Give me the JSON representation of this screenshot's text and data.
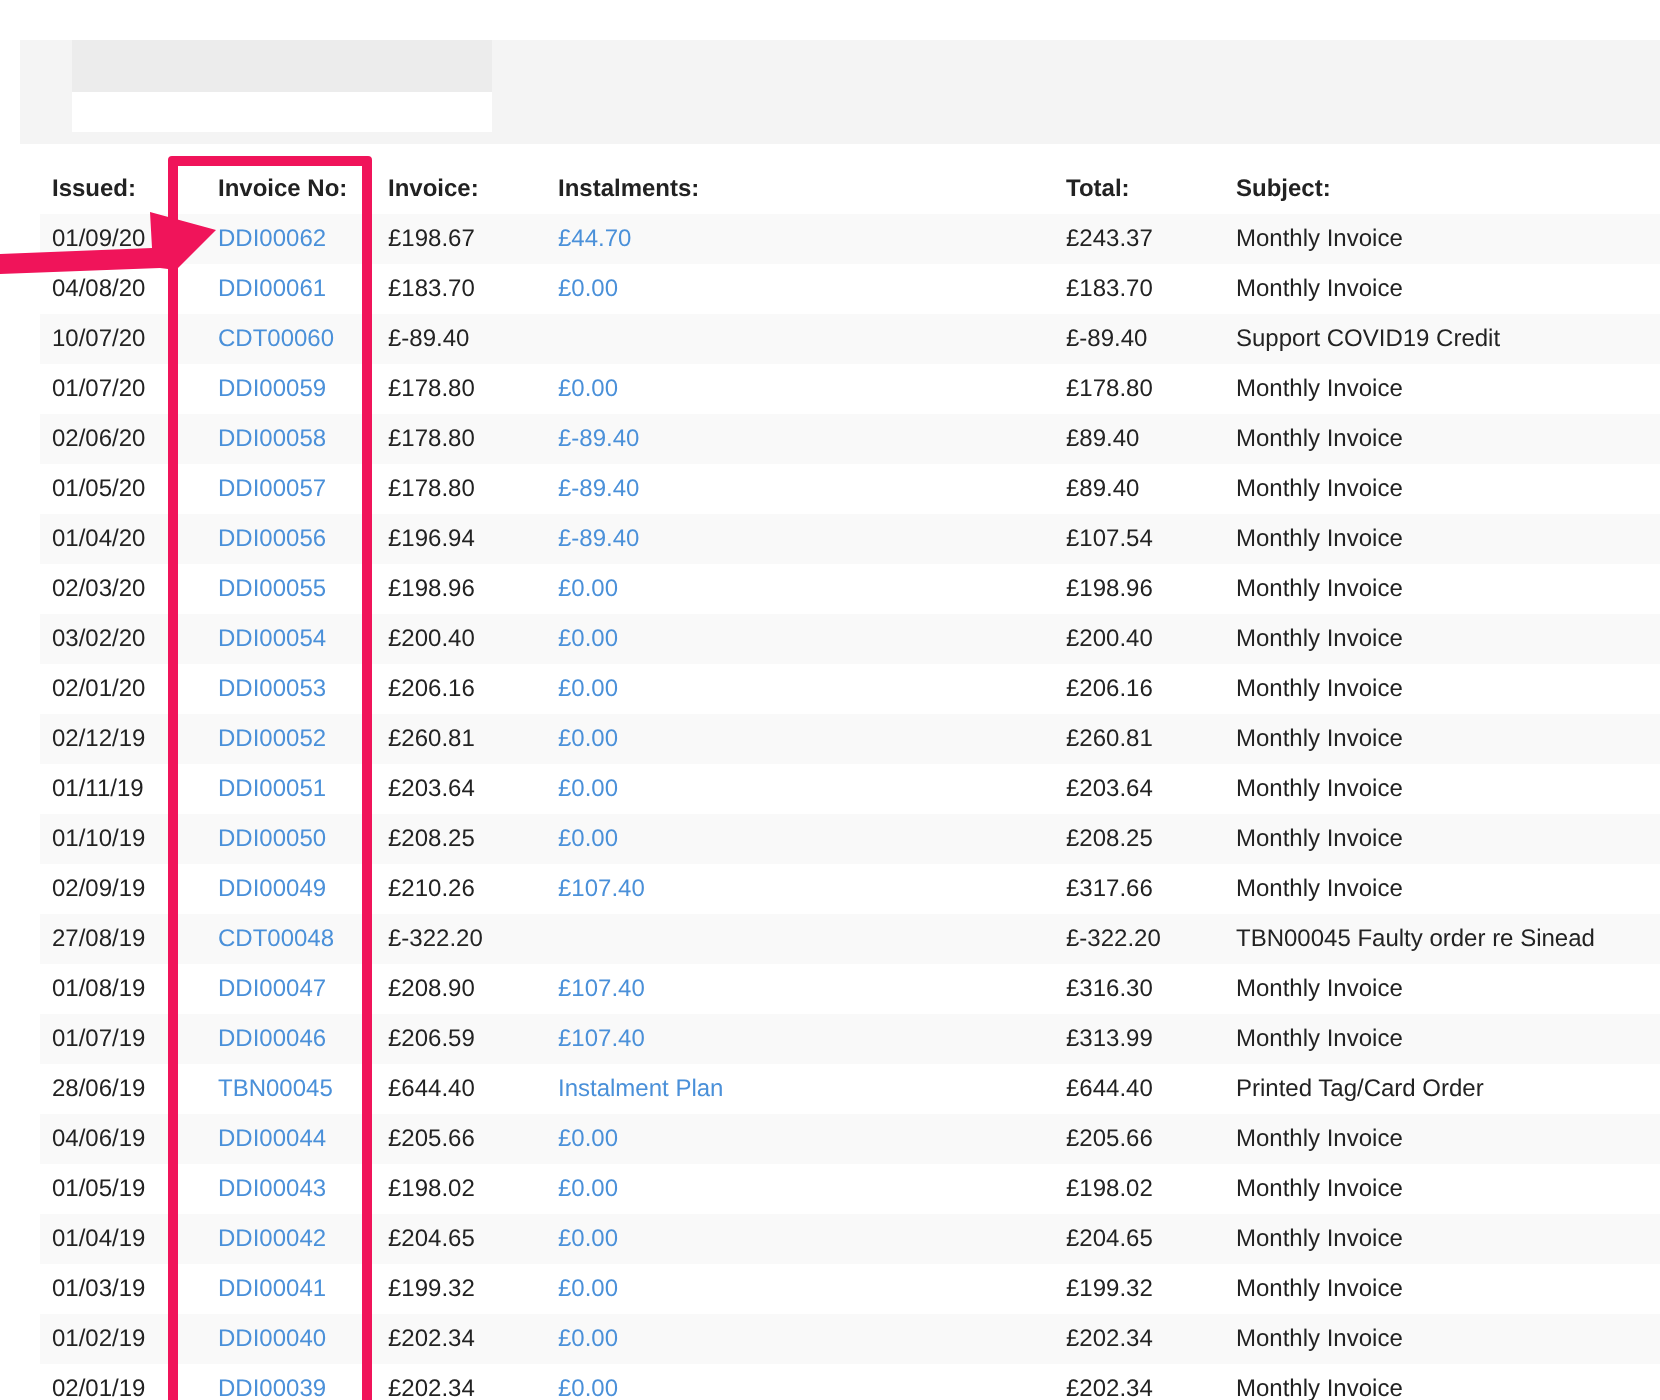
{
  "table": {
    "columns": [
      "Issued:",
      "Invoice No:",
      "Invoice:",
      "Instalments:",
      "Total:",
      "Subject:"
    ],
    "rows": [
      {
        "issued": "01/09/20",
        "invoice_no": "DDI00062",
        "invoice": "£198.67",
        "instalments": "£44.70",
        "total": "£243.37",
        "subject": "Monthly Invoice"
      },
      {
        "issued": "04/08/20",
        "invoice_no": "DDI00061",
        "invoice": "£183.70",
        "instalments": "£0.00",
        "total": "£183.70",
        "subject": "Monthly Invoice"
      },
      {
        "issued": "10/07/20",
        "invoice_no": "CDT00060",
        "invoice": "£-89.40",
        "total": "£-89.40",
        "subject": "Support COVID19 Credit"
      },
      {
        "issued": "01/07/20",
        "invoice_no": "DDI00059",
        "invoice": "£178.80",
        "instalments": "£0.00",
        "total": "£178.80",
        "subject": "Monthly Invoice"
      },
      {
        "issued": "02/06/20",
        "invoice_no": "DDI00058",
        "invoice": "£178.80",
        "instalments": "£-89.40",
        "total": "£89.40",
        "subject": "Monthly Invoice"
      },
      {
        "issued": "01/05/20",
        "invoice_no": "DDI00057",
        "invoice": "£178.80",
        "instalments": "£-89.40",
        "total": "£89.40",
        "subject": "Monthly Invoice"
      },
      {
        "issued": "01/04/20",
        "invoice_no": "DDI00056",
        "invoice": "£196.94",
        "instalments": "£-89.40",
        "total": "£107.54",
        "subject": "Monthly Invoice"
      },
      {
        "issued": "02/03/20",
        "invoice_no": "DDI00055",
        "invoice": "£198.96",
        "instalments": "£0.00",
        "total": "£198.96",
        "subject": "Monthly Invoice"
      },
      {
        "issued": "03/02/20",
        "invoice_no": "DDI00054",
        "invoice": "£200.40",
        "instalments": "£0.00",
        "total": "£200.40",
        "subject": "Monthly Invoice"
      },
      {
        "issued": "02/01/20",
        "invoice_no": "DDI00053",
        "invoice": "£206.16",
        "instalments": "£0.00",
        "total": "£206.16",
        "subject": "Monthly Invoice"
      },
      {
        "issued": "02/12/19",
        "invoice_no": "DDI00052",
        "invoice": "£260.81",
        "instalments": "£0.00",
        "total": "£260.81",
        "subject": "Monthly Invoice"
      },
      {
        "issued": "01/11/19",
        "invoice_no": "DDI00051",
        "invoice": "£203.64",
        "instalments": "£0.00",
        "total": "£203.64",
        "subject": "Monthly Invoice"
      },
      {
        "issued": "01/10/19",
        "invoice_no": "DDI00050",
        "invoice": "£208.25",
        "instalments": "£0.00",
        "total": "£208.25",
        "subject": "Monthly Invoice"
      },
      {
        "issued": "02/09/19",
        "invoice_no": "DDI00049",
        "invoice": "£210.26",
        "instalments": "£107.40",
        "total": "£317.66",
        "subject": "Monthly Invoice"
      },
      {
        "issued": "27/08/19",
        "invoice_no": "CDT00048",
        "invoice": "£-322.20",
        "total": "£-322.20",
        "subject": "TBN00045 Faulty order re Sinead"
      },
      {
        "issued": "01/08/19",
        "invoice_no": "DDI00047",
        "invoice": "£208.90",
        "instalments": "£107.40",
        "total": "£316.30",
        "subject": "Monthly Invoice"
      },
      {
        "issued": "01/07/19",
        "invoice_no": "DDI00046",
        "invoice": "£206.59",
        "instalments": "£107.40",
        "total": "£313.99",
        "subject": "Monthly Invoice"
      },
      {
        "issued": "28/06/19",
        "invoice_no": "TBN00045",
        "invoice": "£644.40",
        "instalments": "Instalment Plan",
        "total": "£644.40",
        "subject": "Printed Tag/Card Order"
      },
      {
        "issued": "04/06/19",
        "invoice_no": "DDI00044",
        "invoice": "£205.66",
        "instalments": "£0.00",
        "total": "£205.66",
        "subject": "Monthly Invoice"
      },
      {
        "issued": "01/05/19",
        "invoice_no": "DDI00043",
        "invoice": "£198.02",
        "instalments": "£0.00",
        "total": "£198.02",
        "subject": "Monthly Invoice"
      },
      {
        "issued": "01/04/19",
        "invoice_no": "DDI00042",
        "invoice": "£204.65",
        "instalments": "£0.00",
        "total": "£204.65",
        "subject": "Monthly Invoice"
      },
      {
        "issued": "01/03/19",
        "invoice_no": "DDI00041",
        "invoice": "£199.32",
        "instalments": "£0.00",
        "total": "£199.32",
        "subject": "Monthly Invoice"
      },
      {
        "issued": "01/02/19",
        "invoice_no": "DDI00040",
        "invoice": "£202.34",
        "instalments": "£0.00",
        "total": "£202.34",
        "subject": "Monthly Invoice"
      },
      {
        "issued": "02/01/19",
        "invoice_no": "DDI00039",
        "invoice": "£202.34",
        "instalments": "£0.00",
        "total": "£202.34",
        "subject": "Monthly Invoice"
      }
    ]
  }
}
